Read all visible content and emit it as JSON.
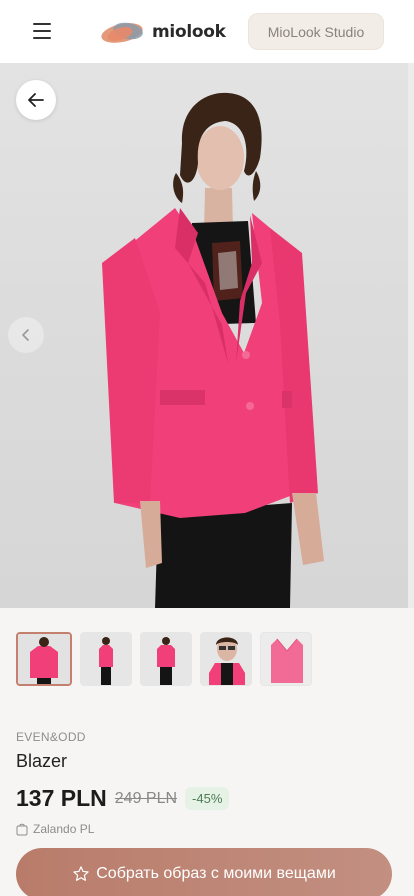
{
  "header": {
    "logo_text": "miolook",
    "studio_button_label": "MioLook Studio"
  },
  "icons": {
    "menu": "hamburger-icon",
    "back": "arrow-left-icon",
    "prev": "chevron-left-icon",
    "store": "shopping-bag-icon",
    "cta": "star-icon"
  },
  "product": {
    "brand": "EVEN&ODD",
    "name": "Blazer",
    "price": "137 PLN",
    "old_price": "249 PLN",
    "discount": "-45%",
    "store": "Zalando PL"
  },
  "thumbnails_count": 5,
  "cta": {
    "label": "Собрать образ с моими вещами"
  },
  "colors": {
    "accent": "#c08878",
    "blazer": "#f03f79",
    "discount_bg": "#e6f2e6",
    "discount_text": "#4e7d55"
  }
}
